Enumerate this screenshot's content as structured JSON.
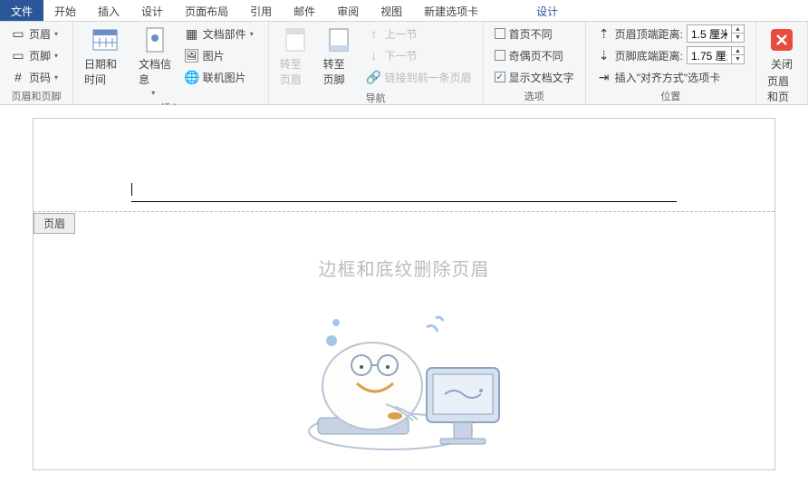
{
  "tabs": {
    "file": "文件",
    "home": "开始",
    "insert": "插入",
    "design": "设计",
    "layout": "页面布局",
    "references": "引用",
    "mailings": "邮件",
    "review": "审阅",
    "view": "视图",
    "newtab": "新建选项卡",
    "hf_design": "设计"
  },
  "grp_hf": {
    "header": "页眉",
    "footer": "页脚",
    "pagenum": "页码",
    "label": "页眉和页脚"
  },
  "grp_insert": {
    "datetime": "日期和时间",
    "docinfo": "文档信息",
    "parts": "文档部件",
    "picture": "图片",
    "online_pic": "联机图片",
    "label": "插入"
  },
  "grp_nav": {
    "goto_header": "转至页眉",
    "goto_footer": "转至页脚",
    "prev": "上一节",
    "next": "下一节",
    "link_prev": "链接到前一条页眉",
    "label": "导航"
  },
  "grp_options": {
    "first_diff": "首页不同",
    "odd_even_diff": "奇偶页不同",
    "show_text": "显示文档文字",
    "show_text_checked": true,
    "label": "选项"
  },
  "grp_position": {
    "header_top": "页眉顶端距离:",
    "header_top_val": "1.5 厘米",
    "footer_bottom": "页脚底端距离:",
    "footer_bottom_val": "1.75 厘米",
    "align_tab": "插入\"对齐方式\"选项卡",
    "label": "位置"
  },
  "grp_close": {
    "close_btn": "关闭\n页眉和页脚",
    "close_line1": "关闭",
    "close_line2": "页眉和页脚",
    "label": "关闭"
  },
  "doc": {
    "header_tag": "页眉",
    "body_title": "边框和底纹删除页眉"
  }
}
